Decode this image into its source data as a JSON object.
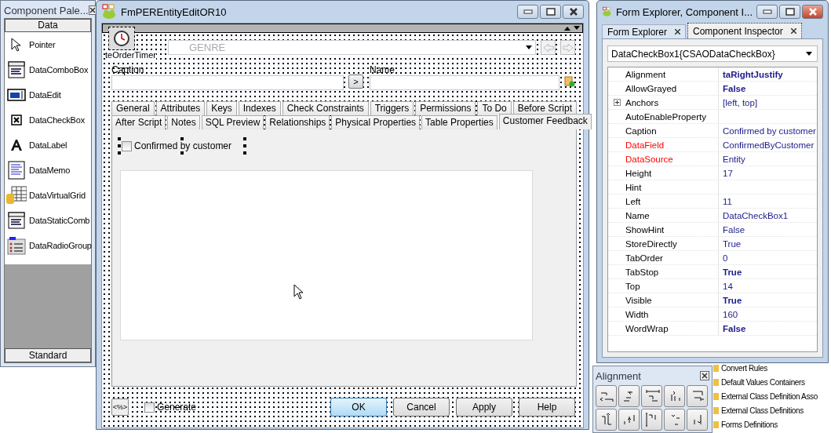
{
  "palette": {
    "title": "Component Pale...",
    "group": "Data",
    "footer": "Standard",
    "items": [
      {
        "label": "Pointer",
        "kind": "pointer"
      },
      {
        "label": "DataComboBox",
        "kind": "combo"
      },
      {
        "label": "DataEdit",
        "kind": "edit"
      },
      {
        "label": "DataCheckBox",
        "kind": "check"
      },
      {
        "label": "DataLabel",
        "kind": "label"
      },
      {
        "label": "DataMemo",
        "kind": "memo"
      },
      {
        "label": "DataVirtualGrid",
        "kind": "grid"
      },
      {
        "label": "DataStaticComb",
        "kind": "combo"
      },
      {
        "label": "DataRadioGroup",
        "kind": "radio"
      }
    ]
  },
  "form": {
    "title": "FmPEREntityEditOR10",
    "active": false,
    "timer_label": "teOrderTimer",
    "combo_value": "GENRE",
    "caption_label": "Caption",
    "go_button": ">",
    "name_label": "Name",
    "tab_rows": [
      [
        {
          "label": "General",
          "selected": false
        },
        {
          "label": "Attributes",
          "selected": false
        },
        {
          "label": "Keys",
          "selected": false
        },
        {
          "label": "Indexes",
          "selected": false
        },
        {
          "label": "Check Constraints",
          "selected": false
        },
        {
          "label": "Triggers",
          "selected": false
        },
        {
          "label": "Permissions",
          "selected": false
        },
        {
          "label": "To Do",
          "selected": false
        },
        {
          "label": "Before Script",
          "selected": false
        }
      ],
      [
        {
          "label": "After Script",
          "selected": false
        },
        {
          "label": "Notes",
          "selected": false
        },
        {
          "label": "SQL Preview",
          "selected": false
        },
        {
          "label": "Relationships",
          "selected": false
        },
        {
          "label": "Physical Properties",
          "selected": false
        },
        {
          "label": "Table Properties",
          "selected": false
        },
        {
          "label": "Customer Feedback",
          "selected": true
        }
      ]
    ],
    "checkbox": {
      "label": "Confirmed by customer",
      "checked": false
    },
    "script_button": "<%>",
    "generate": {
      "label": "Generate",
      "checked": false
    },
    "buttons": [
      {
        "label": "OK",
        "default": true
      },
      {
        "label": "Cancel",
        "default": false
      },
      {
        "label": "Apply",
        "default": false
      },
      {
        "label": "Help",
        "default": false
      }
    ]
  },
  "inspector": {
    "title": "Form Explorer, Component I...",
    "active": true,
    "tabs": [
      {
        "label": "Form Explorer",
        "selected": false
      },
      {
        "label": "Component Inspector",
        "selected": true
      }
    ],
    "object": "DataCheckBox1{CSAODataCheckBox}",
    "properties": [
      {
        "name": "Alignment",
        "value": "taRightJustify",
        "bold": true,
        "required": false,
        "expandable": false
      },
      {
        "name": "AllowGrayed",
        "value": "False",
        "bold": true,
        "required": false,
        "expandable": false
      },
      {
        "name": "Anchors",
        "value": "[left, top]",
        "bold": false,
        "required": false,
        "expandable": true
      },
      {
        "name": "AutoEnableProperty",
        "required": false,
        "expandable": false
      },
      {
        "name": "Caption",
        "value": "Confirmed by customer",
        "bold": false,
        "required": false,
        "expandable": false
      },
      {
        "name": "DataField",
        "value": "ConfirmedByCustomer",
        "bold": false,
        "required": true,
        "expandable": false
      },
      {
        "name": "DataSource",
        "value": "Entity",
        "bold": false,
        "required": true,
        "expandable": false
      },
      {
        "name": "Height",
        "value": "17",
        "bold": false,
        "required": false,
        "expandable": false
      },
      {
        "name": "Hint",
        "required": false,
        "expandable": false
      },
      {
        "name": "Left",
        "value": "11",
        "bold": false,
        "required": false,
        "expandable": false
      },
      {
        "name": "Name",
        "value": "DataCheckBox1",
        "bold": false,
        "required": false,
        "expandable": false
      },
      {
        "name": "ShowHint",
        "value": "False",
        "bold": false,
        "required": false,
        "expandable": false
      },
      {
        "name": "StoreDirectly",
        "value": "True",
        "bold": false,
        "required": false,
        "expandable": false
      },
      {
        "name": "TabOrder",
        "value": "0",
        "bold": false,
        "required": false,
        "expandable": false
      },
      {
        "name": "TabStop",
        "value": "True",
        "bold": true,
        "required": false,
        "expandable": false
      },
      {
        "name": "Top",
        "value": "14",
        "bold": false,
        "required": false,
        "expandable": false
      },
      {
        "name": "Visible",
        "value": "True",
        "bold": true,
        "required": false,
        "expandable": false
      },
      {
        "name": "Width",
        "value": "160",
        "bold": false,
        "required": false,
        "expandable": false
      },
      {
        "name": "WordWrap",
        "value": "False",
        "bold": true,
        "required": false,
        "expandable": false
      }
    ]
  },
  "alignment": {
    "title": "Alignment"
  },
  "tree": {
    "items": [
      {
        "label": "Convert Rules"
      },
      {
        "label": "Default Values Containers"
      },
      {
        "label": "External Class Definition Asso"
      },
      {
        "label": "External Class Definitions"
      },
      {
        "label": "Forms Definitions"
      }
    ]
  }
}
